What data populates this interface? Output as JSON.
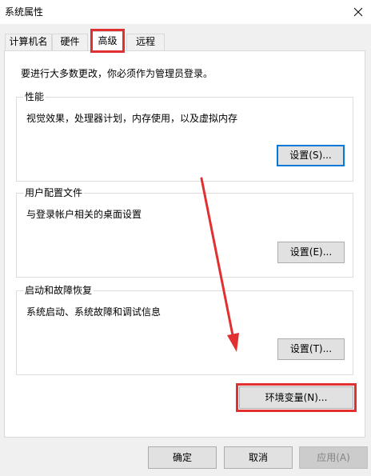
{
  "window": {
    "title": "系统属性"
  },
  "tabs": [
    {
      "label": "计算机名"
    },
    {
      "label": "硬件"
    },
    {
      "label": "高级"
    },
    {
      "label": "远程"
    }
  ],
  "intro_text": "要进行大多数更改，你必须作为管理员登录。",
  "groups": {
    "performance": {
      "title": "性能",
      "description": "视觉效果，处理器计划，内存使用，以及虚拟内存",
      "button": "设置(S)..."
    },
    "user_profiles": {
      "title": "用户配置文件",
      "description": "与登录帐户相关的桌面设置",
      "button": "设置(E)..."
    },
    "startup_recovery": {
      "title": "启动和故障恢复",
      "description": "系统启动、系统故障和调试信息",
      "button": "设置(T)..."
    }
  },
  "env_button": "环境变量(N)...",
  "footer": {
    "ok": "确定",
    "cancel": "取消",
    "apply": "应用(A)"
  },
  "annotation_color": "#e03030",
  "accent": "#0078d7"
}
